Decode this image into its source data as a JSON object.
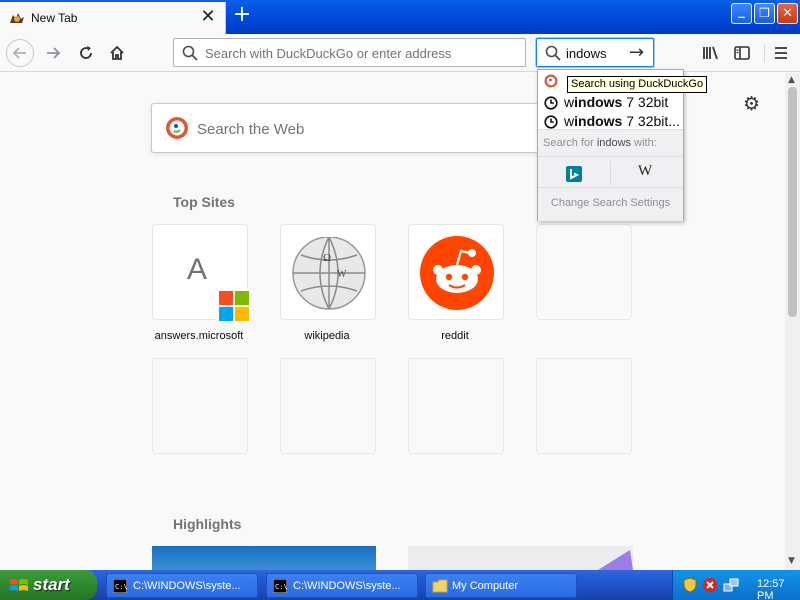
{
  "window": {
    "tab_title": "New Tab",
    "new_tab_symbol": "+",
    "min_symbol": "_",
    "max_symbol": "❐",
    "close_symbol": "✕"
  },
  "toolbar": {
    "address_placeholder": "Search with DuckDuckGo or enter address",
    "search_value": "indows",
    "back_icon": "back-arrow-icon",
    "forward_icon": "forward-arrow-icon"
  },
  "search_popup": {
    "tooltip": "Search using DuckDuckGo",
    "suggestions": [
      {
        "prefix": "w",
        "bold": "indows",
        "rest": " 7 32bit"
      },
      {
        "prefix": "w",
        "bold": "indows",
        "rest": " 7 32bit..."
      }
    ],
    "search_for_label": "Search for",
    "search_for_query": "indows",
    "search_for_suffix": "with:",
    "wiki_letter": "W",
    "change_settings": "Change Search Settings"
  },
  "newtab": {
    "web_search_placeholder": "Search the Web",
    "top_sites_title": "Top Sites",
    "highlights_title": "Highlights",
    "top_sites": [
      {
        "label": "answers.microsoft",
        "letter": "A"
      },
      {
        "label": "wikipedia"
      },
      {
        "label": "reddit"
      }
    ]
  },
  "taskbar": {
    "start_label": "start",
    "tasks": [
      {
        "label": "C:\\WINDOWS\\syste..."
      },
      {
        "label": "C:\\WINDOWS\\syste..."
      },
      {
        "label": "My Computer"
      }
    ],
    "clock": "12:57 PM"
  }
}
